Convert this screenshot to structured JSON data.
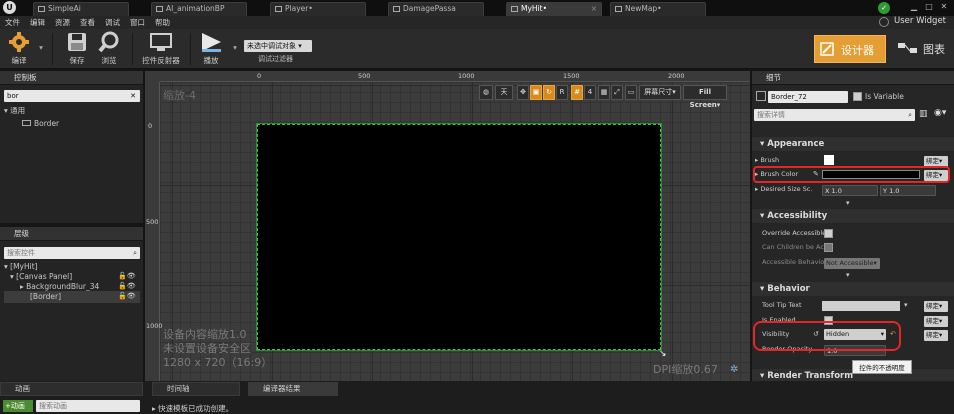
{
  "tabs": [
    {
      "label": "SimpleAi",
      "active": false
    },
    {
      "label": "AI_animationBP",
      "active": false
    },
    {
      "label": "Player•",
      "active": false
    },
    {
      "label": "DamagePassa",
      "active": false
    },
    {
      "label": "MyHit•",
      "active": true
    },
    {
      "label": "NewMap•",
      "active": false
    }
  ],
  "user_widget": "User Widget",
  "menu": [
    "文件",
    "编辑",
    "资源",
    "查看",
    "调试",
    "窗口",
    "帮助"
  ],
  "toolbar": {
    "compile": "编译",
    "save": "保存",
    "browse": "浏览",
    "reflector": "控件反射器",
    "play": "播放",
    "debug_select": "未选中调试对象",
    "debug_filter": "调试过滤器",
    "designer": "设计器",
    "graph": "图表"
  },
  "palette": {
    "title": "控制板",
    "search_value": "bor",
    "category": "通用",
    "item": "Border"
  },
  "hierarchy": {
    "title": "层级",
    "search_placeholder": "搜索控件",
    "rows": [
      "[MyHit]",
      "[Canvas Panel]",
      "BackgroundBlur_34",
      "[Border]"
    ]
  },
  "viewport": {
    "zoom": "缩放-4",
    "ruler_top": [
      "0",
      "500",
      "1000",
      "1500",
      "2000"
    ],
    "ruler_left": [
      "0",
      "500",
      "1000"
    ],
    "scale_info": "设备内容缩放1.0",
    "safe_zone": "未设置设备安全区",
    "resolution": "1280 x 720（16:9）",
    "dpi": "DPI缩放0.67",
    "tools": {
      "lang": "天",
      "r": "R",
      "grid": "4",
      "screen_size": "屏幕尺寸",
      "fill_screen": "Fill Screen"
    }
  },
  "details": {
    "title": "细节",
    "name_value": "Border_72",
    "is_variable": "Is Variable",
    "search_placeholder": "搜索详情",
    "appearance": "Appearance",
    "brush": "Brush",
    "brush_color": "Brush Color",
    "desired_size": "Desired Size Sc.",
    "x_label": "X",
    "x_value": "1.0",
    "y_label": "Y",
    "y_value": "1.0",
    "bind": "绑定",
    "accessibility": "Accessibility",
    "override_accessible": "Override Accessible",
    "can_children": "Can Children be Acc",
    "accessible_behavior": "Accessible Behavior",
    "not_accessible": "Not Accessible",
    "behavior": "Behavior",
    "tool_tip": "Tool Tip Text",
    "is_enabled": "Is Enabled",
    "visibility": "Visibility",
    "visibility_value": "Hidden",
    "render_opacity": "Render Opacity",
    "render_opacity_value": "1.0",
    "tooltip": "控件的不透明度",
    "render_transform": "Render Transform"
  },
  "bottom": {
    "animation": "动画",
    "add_anim": "+动画",
    "search_anim": "搜索动画",
    "timeline": "时间轴",
    "compiler_results": "编译器结果",
    "message": "快速模板已成功创建。"
  },
  "colors": {
    "accent": "#e49e34",
    "canvas_border": "#3cc34a",
    "highlight": "#e32626"
  }
}
